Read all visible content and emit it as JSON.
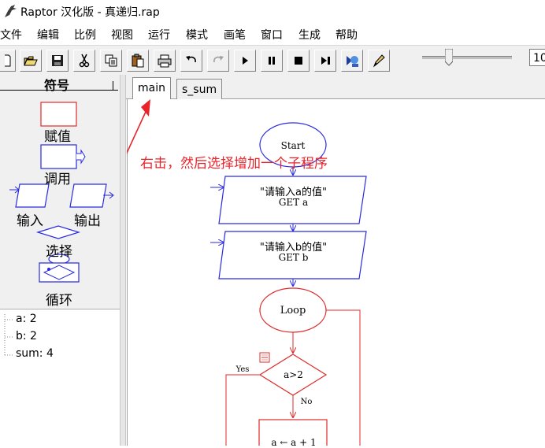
{
  "window": {
    "title": "Raptor 汉化版 - 真递归.rap"
  },
  "menu": [
    "文件",
    "编辑",
    "比例",
    "视图",
    "运行",
    "模式",
    "画笔",
    "窗口",
    "生成",
    "帮助"
  ],
  "toolbar": {
    "buttons": [
      "new-icon",
      "open-icon",
      "save-icon",
      "cut-icon",
      "copy-icon",
      "paste-icon",
      "print-icon",
      "undo-icon",
      "redo-icon",
      "play-icon",
      "pause-icon",
      "stop-icon",
      "step-icon",
      "test-server-icon",
      "pen-icon"
    ],
    "zoom_value": "10",
    "speed_level": 0.3
  },
  "symbols": {
    "header": "符号",
    "assign": "赋值",
    "call": "调用",
    "input": "输入",
    "output": "输出",
    "select": "选择",
    "loop": "循环"
  },
  "variables": [
    "a: 2",
    "b: 2",
    "sum: 4"
  ],
  "tabs": [
    "main",
    "s_sum"
  ],
  "annotation": {
    "text": "右击，然后选择增加一个子程序",
    "color": "#e8232b"
  },
  "flowchart": {
    "start": "Start",
    "input1_prompt": "\"请输入a的值\"",
    "input1_cmd": "GET a",
    "input2_prompt": "\"请输入b的值\"",
    "input2_cmd": "GET b",
    "loop": "Loop",
    "condition": "a>2",
    "yes": "Yes",
    "no": "No",
    "assign": "a ← a + 1",
    "colors": {
      "normal": "#2a2ae0",
      "active": "#e02a2a"
    }
  }
}
